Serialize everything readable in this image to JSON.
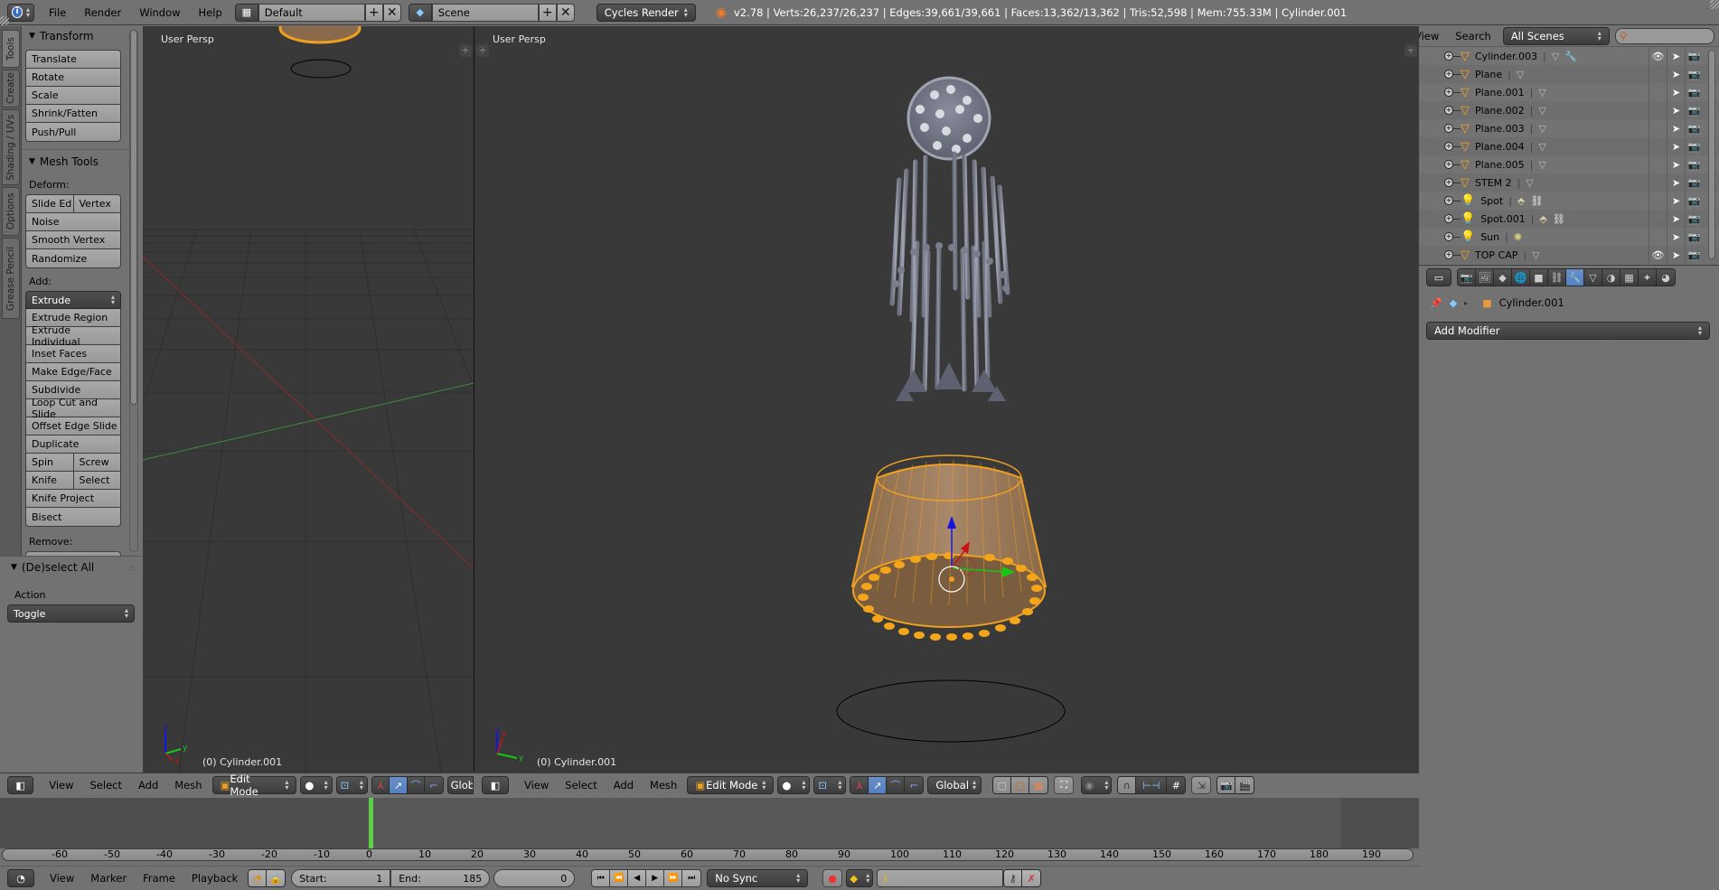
{
  "topbar": {
    "menus": [
      "File",
      "Render",
      "Window",
      "Help"
    ],
    "screen_layout": "Default",
    "scene": "Scene",
    "render_engine": "Cycles Render",
    "stats": "v2.78 | Verts:26,237/26,237 | Edges:39,661/39,661 | Faces:13,362/13,362 | Tris:52,598 | Mem:755.33M | Cylinder.001"
  },
  "tool_tabs": [
    "Tools",
    "Create",
    "Shading / UVs",
    "Options",
    "Grease Pencil"
  ],
  "tool_panel": {
    "transform": {
      "title": "Transform",
      "buttons": [
        "Translate",
        "Rotate",
        "Scale",
        "Shrink/Fatten",
        "Push/Pull"
      ]
    },
    "mesh_tools": {
      "title": "Mesh Tools",
      "deform_label": "Deform:",
      "deform_split": [
        "Slide Ed",
        "Vertex"
      ],
      "deform_buttons": [
        "Noise",
        "Smooth Vertex",
        "Randomize"
      ],
      "add_label": "Add:",
      "extrude_dropdown": "Extrude",
      "add_buttons": [
        "Extrude Region",
        "Extrude Individual",
        "Inset Faces",
        "Make Edge/Face",
        "Subdivide",
        "Loop Cut and Slide",
        "Offset Edge Slide",
        "Duplicate"
      ],
      "split_row_1": [
        "Spin",
        "Screw"
      ],
      "split_row_2": [
        "Knife",
        "Select"
      ],
      "more_buttons": [
        "Knife Project",
        "Bisect"
      ],
      "remove_label": "Remove:"
    }
  },
  "operator_panel": {
    "title": "(De)select All",
    "action_label": "Action",
    "action_value": "Toggle"
  },
  "viewport_left": {
    "label": "User Persp",
    "object_info": "(0) Cylinder.001",
    "menus": [
      "View",
      "Select",
      "Add",
      "Mesh"
    ],
    "mode": "Edit Mode",
    "orientation": "Globa"
  },
  "viewport_main": {
    "label": "User Persp",
    "object_info": "(0) Cylinder.001",
    "menus": [
      "View",
      "Select",
      "Add",
      "Mesh"
    ],
    "mode": "Edit Mode",
    "orientation": "Global"
  },
  "outliner": {
    "header_menus": [
      "View",
      "Search"
    ],
    "scene_filter": "All Scenes",
    "search_placeholder": "",
    "items": [
      {
        "name": "Cylinder.003",
        "type": "mesh",
        "extras": [
          "mesh-data",
          "modifier"
        ],
        "visible": true,
        "renderable": true
      },
      {
        "name": "Plane",
        "type": "mesh",
        "extras": [
          "mesh-data"
        ],
        "visible": false,
        "renderable": true
      },
      {
        "name": "Plane.001",
        "type": "mesh",
        "extras": [
          "mesh-data"
        ],
        "visible": false,
        "renderable": true
      },
      {
        "name": "Plane.002",
        "type": "mesh",
        "extras": [
          "mesh-data"
        ],
        "visible": false,
        "renderable": false
      },
      {
        "name": "Plane.003",
        "type": "mesh",
        "extras": [
          "mesh-data"
        ],
        "visible": false,
        "renderable": true
      },
      {
        "name": "Plane.004",
        "type": "mesh",
        "extras": [
          "mesh-data"
        ],
        "visible": false,
        "renderable": true
      },
      {
        "name": "Plane.005",
        "type": "mesh",
        "extras": [
          "mesh-data"
        ],
        "visible": false,
        "renderable": true
      },
      {
        "name": "STEM 2",
        "type": "mesh",
        "extras": [
          "mesh-data"
        ],
        "visible": false,
        "renderable": true
      },
      {
        "name": "Spot",
        "type": "lamp",
        "extras": [
          "spot-lamp",
          "constraint"
        ],
        "visible": false,
        "renderable": true
      },
      {
        "name": "Spot.001",
        "type": "lamp",
        "extras": [
          "spot-lamp",
          "constraint"
        ],
        "visible": false,
        "renderable": true
      },
      {
        "name": "Sun",
        "type": "lamp",
        "extras": [
          "sun-lamp"
        ],
        "visible": false,
        "renderable": true
      },
      {
        "name": "TOP CAP",
        "type": "mesh",
        "extras": [
          "mesh-data"
        ],
        "visible": true,
        "renderable": true
      }
    ]
  },
  "properties": {
    "tabs": [
      "render",
      "render-layers",
      "scene",
      "world",
      "object",
      "constraints",
      "modifiers",
      "data",
      "material",
      "texture",
      "particles",
      "physics"
    ],
    "active_tab": "modifiers",
    "context_object": "Cylinder.001",
    "add_modifier_label": "Add Modifier"
  },
  "timeline": {
    "ticks": [
      -60,
      -50,
      -40,
      -30,
      -20,
      -10,
      0,
      10,
      20,
      30,
      40,
      50,
      60,
      70,
      80,
      90,
      100,
      110,
      120,
      130,
      140,
      150,
      160,
      170,
      180,
      190
    ],
    "menus": [
      "View",
      "Marker",
      "Frame",
      "Playback"
    ],
    "start_label": "Start:",
    "start_value": "1",
    "end_label": "End:",
    "end_value": "185",
    "current_frame": "0",
    "sync": "No Sync"
  },
  "colors": {
    "selection_orange": "#f0a020",
    "active_tab_blue": "#5680c2",
    "viewport_bg": "#393939",
    "panel_bg": "#727272"
  }
}
